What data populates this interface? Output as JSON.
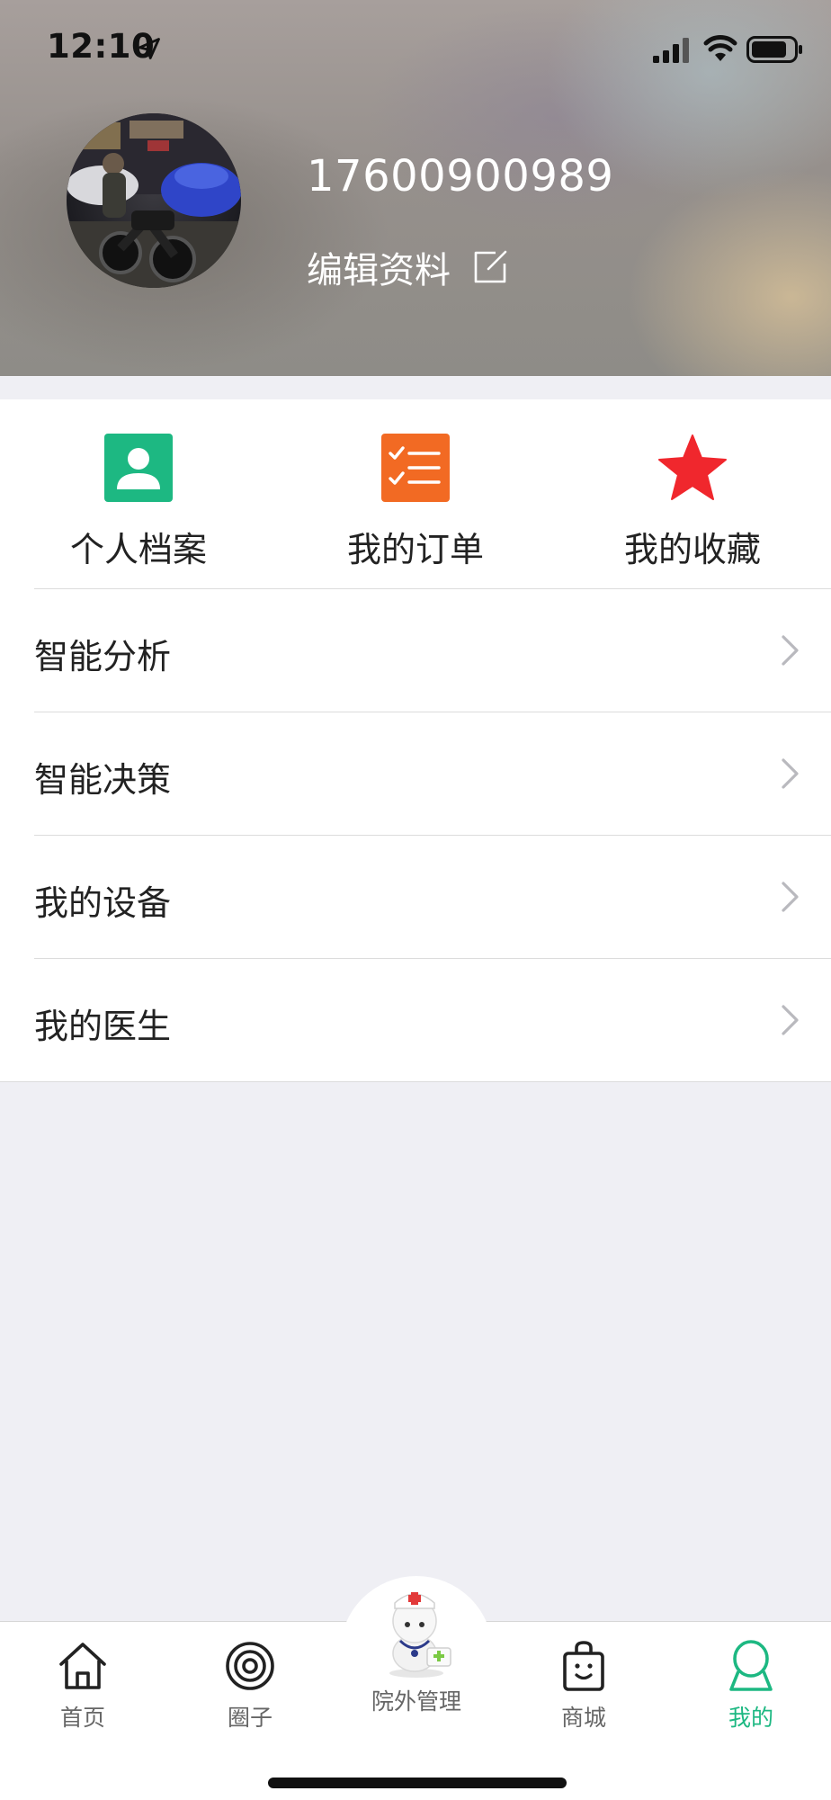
{
  "status_bar": {
    "time": "12:10"
  },
  "profile": {
    "username": "17600900989",
    "edit_label": "编辑资料"
  },
  "quick_actions": [
    {
      "label": "个人档案",
      "icon": "profile-card-icon",
      "color": "#1db882"
    },
    {
      "label": "我的订单",
      "icon": "order-list-icon",
      "color": "#f26a23"
    },
    {
      "label": "我的收藏",
      "icon": "star-icon",
      "color": "#f0272d"
    }
  ],
  "menu": [
    {
      "label": "智能分析"
    },
    {
      "label": "智能决策"
    },
    {
      "label": "我的设备"
    },
    {
      "label": "我的医生"
    }
  ],
  "tabbar": {
    "items": [
      {
        "label": "首页",
        "icon": "home-icon"
      },
      {
        "label": "圈子",
        "icon": "circle-icon"
      },
      {
        "label": "院外管理",
        "icon": "doctor-mascot-icon"
      },
      {
        "label": "商城",
        "icon": "shopping-bag-icon"
      },
      {
        "label": "我的",
        "icon": "user-icon"
      }
    ],
    "active_color": "#1db882",
    "inactive_color": "#666666"
  }
}
